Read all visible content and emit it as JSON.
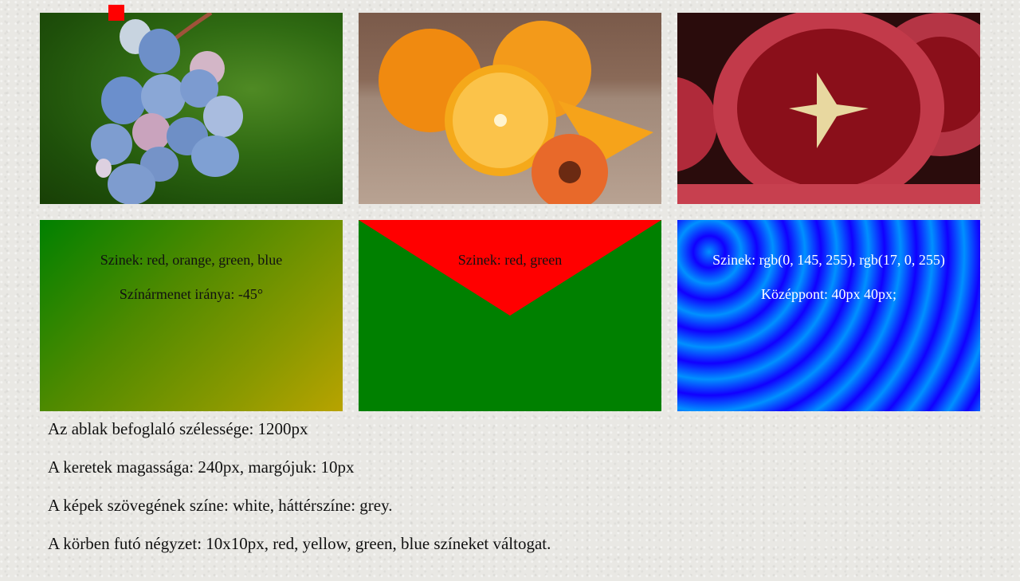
{
  "images": [
    {
      "name": "blueberries"
    },
    {
      "name": "oranges"
    },
    {
      "name": "pomegranate"
    }
  ],
  "gradients": {
    "linear": {
      "line1": "Szinek: red, orange, green, blue",
      "line2": "Színármenet iránya: -45°"
    },
    "conic": {
      "line1": "Szinek: red, green"
    },
    "radial": {
      "line1": "Szinek: rgb(0, 145, 255), rgb(17, 0, 255)",
      "line2": "Középpont: 40px 40px;"
    }
  },
  "moving_square": {
    "color": "#ff0000"
  },
  "notes": [
    "Az ablak befoglaló szélessége: 1200px",
    "A keretek magassága: 240px, margójuk: 10px",
    "A képek szövegének színe: white, háttérszíne: grey.",
    "A körben futó négyzet: 10x10px, red, yellow, green, blue színeket váltogat."
  ],
  "colors": {
    "page_bg": "#e9e8e4",
    "text": "#111111",
    "caption_white": "#ffffff"
  }
}
